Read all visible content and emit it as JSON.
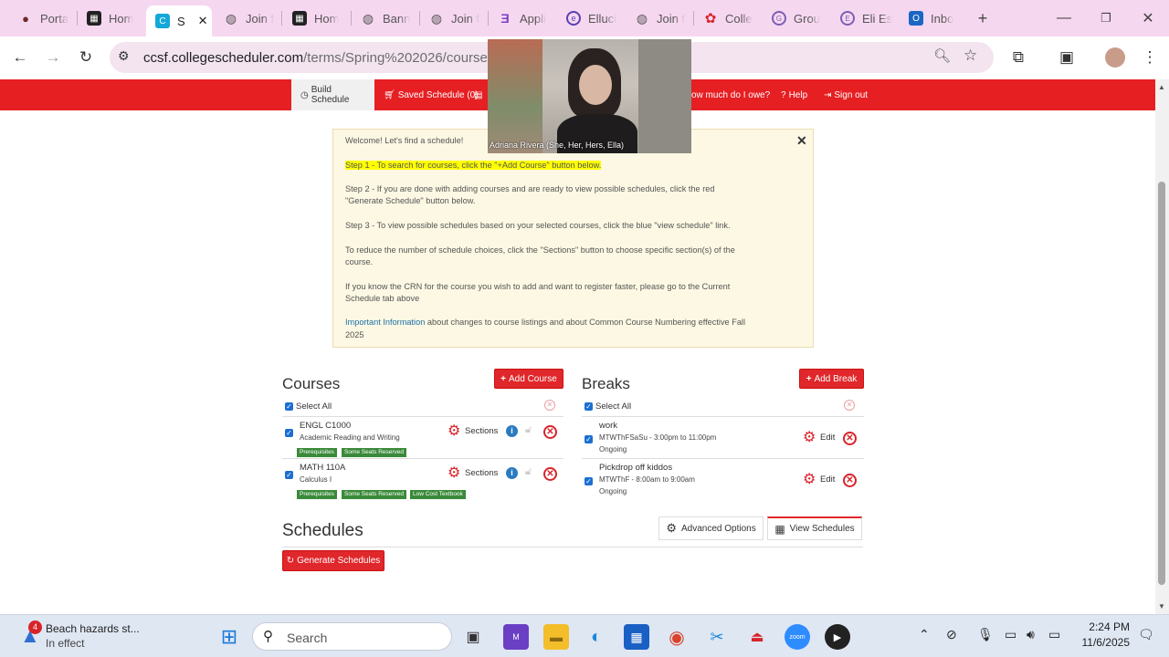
{
  "browser": {
    "tabs": [
      {
        "label": "Porta",
        "icon": "portal-icon"
      },
      {
        "label": "Hom",
        "icon": "ccsf-icon"
      },
      {
        "label": "S",
        "icon": "college-scheduler-icon",
        "active": true
      },
      {
        "label": "Join f",
        "icon": "globe-icon"
      },
      {
        "label": "Hom",
        "icon": "ccsf-icon"
      },
      {
        "label": "Bann",
        "icon": "globe-icon"
      },
      {
        "label": "Join f",
        "icon": "globe-icon"
      },
      {
        "label": "Appli",
        "icon": "ellucian-e-icon"
      },
      {
        "label": "Elluci",
        "icon": "ellucian-icon"
      },
      {
        "label": "Join f",
        "icon": "globe-icon"
      },
      {
        "label": "Colle",
        "icon": "colleague-icon"
      },
      {
        "label": "Grou",
        "icon": "groups-icon"
      },
      {
        "label": "Eli Es",
        "icon": "profile-icon"
      },
      {
        "label": "Inbo",
        "icon": "outlook-icon"
      }
    ],
    "url_host": "ccsf.collegescheduler.com",
    "url_path": "/terms/Spring%202026/courses"
  },
  "video": {
    "caption": "Adriana Rivera (She, Her, Hers, Ella)"
  },
  "nav": {
    "build_schedule": "Build Schedule",
    "saved_schedule": "Saved Schedule (0)",
    "owe": "ow much do I owe?",
    "help": "Help",
    "sign_out": "Sign out"
  },
  "welcome": {
    "line1": "Welcome! Let's find a schedule!",
    "step1": "Step 1 - To search for courses, click the \"+Add Course\" button below.",
    "step2": "Step 2 - If you are done with adding courses and are ready to view possible schedules, click the red \"Generate Schedule\" button below.",
    "step3": "Step 3 - To view possible schedules based on your selected courses, click the blue \"view schedule\" link.",
    "reduce": "To reduce the number of schedule choices, click the \"Sections\" button to choose specific section(s) of the course.",
    "crn": "If you know the CRN for the course you wish to add and want to register faster, please go to the Current Schedule tab above",
    "important_link": "Important Information",
    "important_rest": " about changes to course listings and about Common Course Numbering effective Fall 2025"
  },
  "courses": {
    "heading": "Courses",
    "add_button": "Add Course",
    "select_all": "Select All",
    "sections_label": "Sections",
    "items": [
      {
        "code": "ENGL C1000",
        "title": "Academic Reading and Writing",
        "badges": [
          "Prerequisites",
          "Some Seats Reserved"
        ]
      },
      {
        "code": "MATH 110A",
        "title": "Calculus I",
        "badges": [
          "Prerequisites",
          "Some Seats Reserved",
          "Low Cost Textbook"
        ]
      }
    ]
  },
  "breaks": {
    "heading": "Breaks",
    "add_button": "Add Break",
    "select_all": "Select All",
    "edit_label": "Edit",
    "items": [
      {
        "name": "work",
        "time": "MTWThFSaSu - 3:00pm to 11:00pm",
        "status": "Ongoing"
      },
      {
        "name": "Pickdrop off kiddos",
        "time": "MTWThF - 8:00am to 9:00am",
        "status": "Ongoing"
      }
    ]
  },
  "schedules": {
    "heading": "Schedules",
    "advanced_options": "Advanced Options",
    "view_schedules": "View Schedules",
    "generate": "Generate Schedules"
  },
  "taskbar": {
    "weather_count": "4",
    "weather_title": "Beach hazards st...",
    "weather_sub": "In effect",
    "search_placeholder": "Search",
    "time": "2:24 PM",
    "date": "11/6/2025"
  },
  "colors": {
    "brand_red": "#e61f23",
    "tab_bar": "#f6d7f0",
    "welcome_bg": "#fcf8e3",
    "badge_green": "#3a8a3a"
  }
}
